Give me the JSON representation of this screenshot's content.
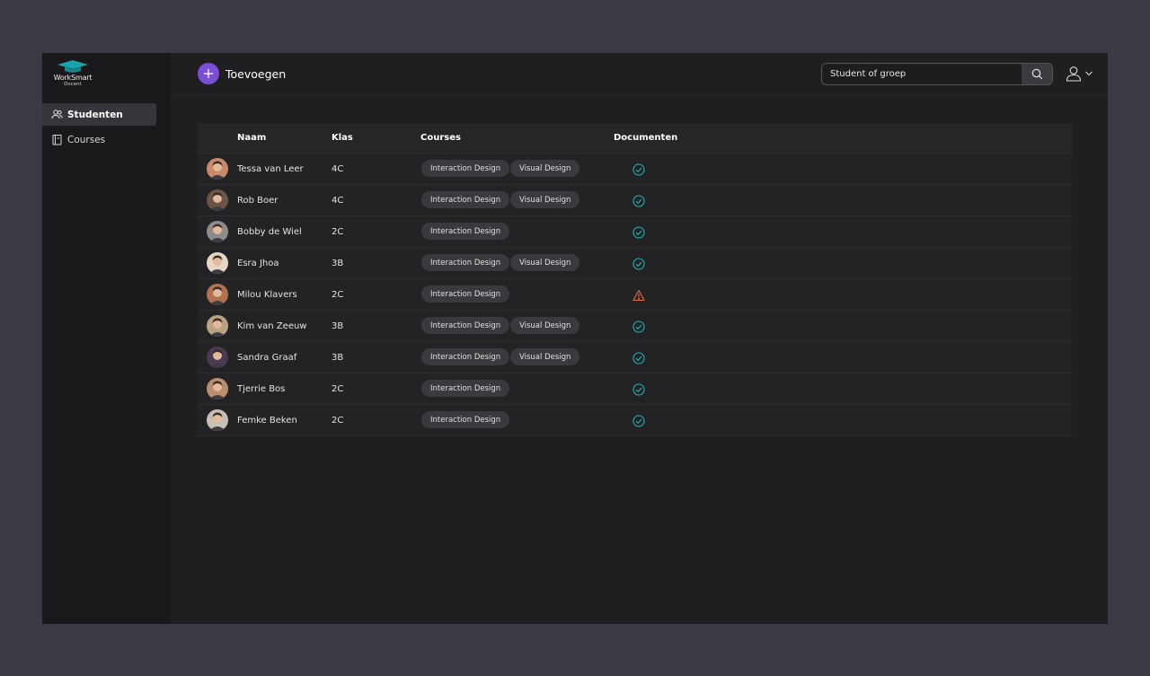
{
  "brand": {
    "name": "WorkSmart",
    "sub": "Docent",
    "accent": "#1aa3a8"
  },
  "header": {
    "add_label": "Toevoegen",
    "search_placeholder": "Student of groep",
    "search_value": ""
  },
  "sidebar": {
    "items": [
      {
        "label": "Studenten",
        "icon": "users-icon",
        "active": true
      },
      {
        "label": "Courses",
        "icon": "book-icon",
        "active": false
      }
    ]
  },
  "table": {
    "columns": [
      "Naam",
      "Klas",
      "Courses",
      "Documenten"
    ],
    "rows": [
      {
        "name": "Tessa van Leer",
        "klas": "4C",
        "courses": [
          "Interaction Design",
          "Visual Design"
        ],
        "doc": "ok",
        "avatar_color": "#c98a6a"
      },
      {
        "name": "Rob Boer",
        "klas": "4C",
        "courses": [
          "Interaction Design",
          "Visual Design"
        ],
        "doc": "ok",
        "avatar_color": "#6b5548"
      },
      {
        "name": "Bobby de Wiel",
        "klas": "2C",
        "courses": [
          "Interaction Design"
        ],
        "doc": "ok",
        "avatar_color": "#8c8c8c"
      },
      {
        "name": "Esra Jhoa",
        "klas": "3B",
        "courses": [
          "Interaction Design",
          "Visual Design"
        ],
        "doc": "ok",
        "avatar_color": "#e7d6c4"
      },
      {
        "name": "Milou Klavers",
        "klas": "2C",
        "courses": [
          "Interaction Design"
        ],
        "doc": "warning",
        "avatar_color": "#b0724f"
      },
      {
        "name": "Kim van Zeeuw",
        "klas": "3B",
        "courses": [
          "Interaction Design",
          "Visual Design"
        ],
        "doc": "ok",
        "avatar_color": "#b9a383"
      },
      {
        "name": "Sandra Graaf",
        "klas": "3B",
        "courses": [
          "Interaction Design",
          "Visual Design"
        ],
        "doc": "ok",
        "avatar_color": "#4a3a52"
      },
      {
        "name": "Tjerrie Bos",
        "klas": "2C",
        "courses": [
          "Interaction Design"
        ],
        "doc": "ok",
        "avatar_color": "#b98d6e"
      },
      {
        "name": "Femke Beken",
        "klas": "2C",
        "courses": [
          "Interaction Design"
        ],
        "doc": "ok",
        "avatar_color": "#c6bfb8"
      }
    ]
  },
  "colors": {
    "ok": "#21b3b6",
    "warning": "#e36b4a",
    "add_button": "#7a4fd6"
  }
}
